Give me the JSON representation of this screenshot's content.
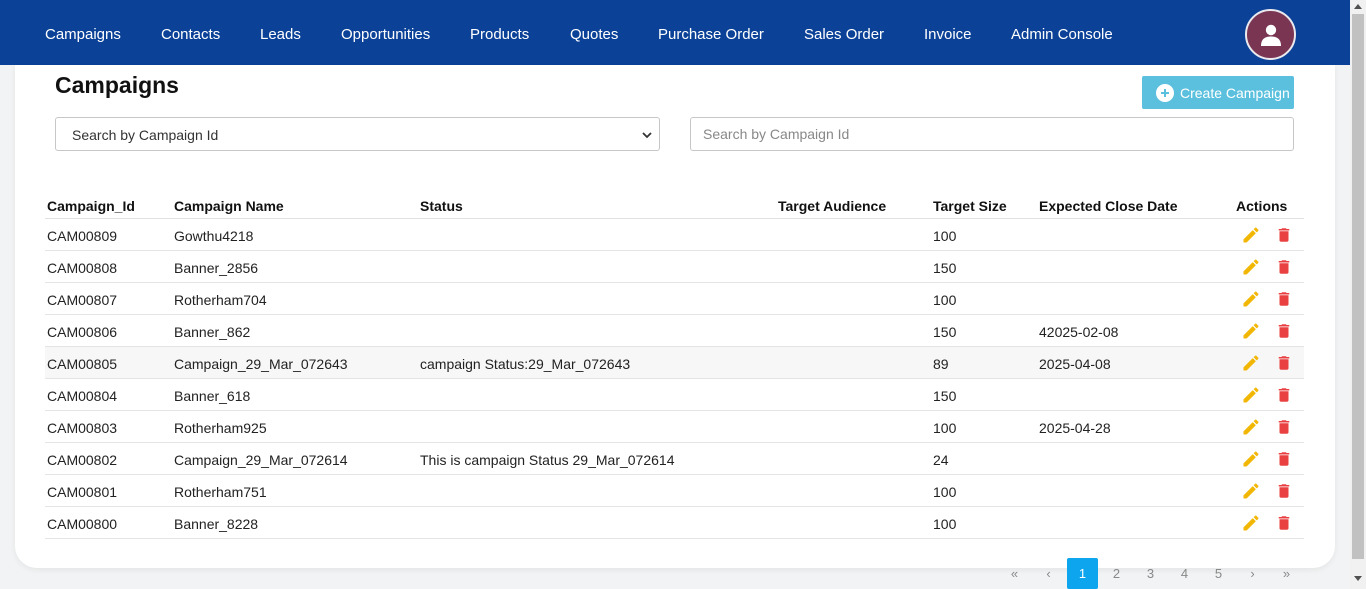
{
  "nav": {
    "items": [
      "Campaigns",
      "Contacts",
      "Leads",
      "Opportunities",
      "Products",
      "Quotes",
      "Purchase Order",
      "Sales Order",
      "Invoice",
      "Admin Console"
    ]
  },
  "page": {
    "title": "Campaigns",
    "create_button_label": "Create Campaign"
  },
  "filters": {
    "select_value": "Search by Campaign Id",
    "search_placeholder": "Search by Campaign Id",
    "search_value": ""
  },
  "table": {
    "columns": [
      "Campaign_Id",
      "Campaign Name",
      "Status",
      "Target Audience",
      "Target Size",
      "Expected Close Date",
      "Actions"
    ],
    "rows": [
      {
        "id": "CAM00809",
        "name": "Gowthu4218",
        "status": "",
        "audience": "",
        "size": "100",
        "close_date": ""
      },
      {
        "id": "CAM00808",
        "name": "Banner_2856",
        "status": "",
        "audience": "",
        "size": "150",
        "close_date": ""
      },
      {
        "id": "CAM00807",
        "name": "Rotherham704",
        "status": "",
        "audience": "",
        "size": "100",
        "close_date": ""
      },
      {
        "id": "CAM00806",
        "name": "Banner_862",
        "status": "",
        "audience": "",
        "size": "150",
        "close_date": "42025-02-08"
      },
      {
        "id": "CAM00805",
        "name": "Campaign_29_Mar_072643",
        "status": "campaign Status:29_Mar_072643",
        "audience": "",
        "size": "89",
        "close_date": "2025-04-08"
      },
      {
        "id": "CAM00804",
        "name": "Banner_618",
        "status": "",
        "audience": "",
        "size": "150",
        "close_date": ""
      },
      {
        "id": "CAM00803",
        "name": "Rotherham925",
        "status": "",
        "audience": "",
        "size": "100",
        "close_date": "2025-04-28"
      },
      {
        "id": "CAM00802",
        "name": "Campaign_29_Mar_072614",
        "status": "This is campaign Status 29_Mar_072614",
        "audience": "",
        "size": "24",
        "close_date": ""
      },
      {
        "id": "CAM00801",
        "name": "Rotherham751",
        "status": "",
        "audience": "",
        "size": "100",
        "close_date": ""
      },
      {
        "id": "CAM00800",
        "name": "Banner_8228",
        "status": "",
        "audience": "",
        "size": "100",
        "close_date": ""
      }
    ],
    "row_actions": [
      "pencil-icon",
      "trash-icon"
    ]
  },
  "pagination": {
    "first": "«",
    "prev": "‹",
    "pages": [
      "1",
      "2",
      "3",
      "4",
      "5"
    ],
    "current": "1",
    "next": "›",
    "last": "»"
  },
  "colors": {
    "navbar": "#0b4297",
    "avatar": "#7a3553",
    "create_button": "#5bc0de",
    "edit_icon": "#f2b705",
    "delete_icon": "#e94141",
    "active_page": "#0ca5ee"
  }
}
